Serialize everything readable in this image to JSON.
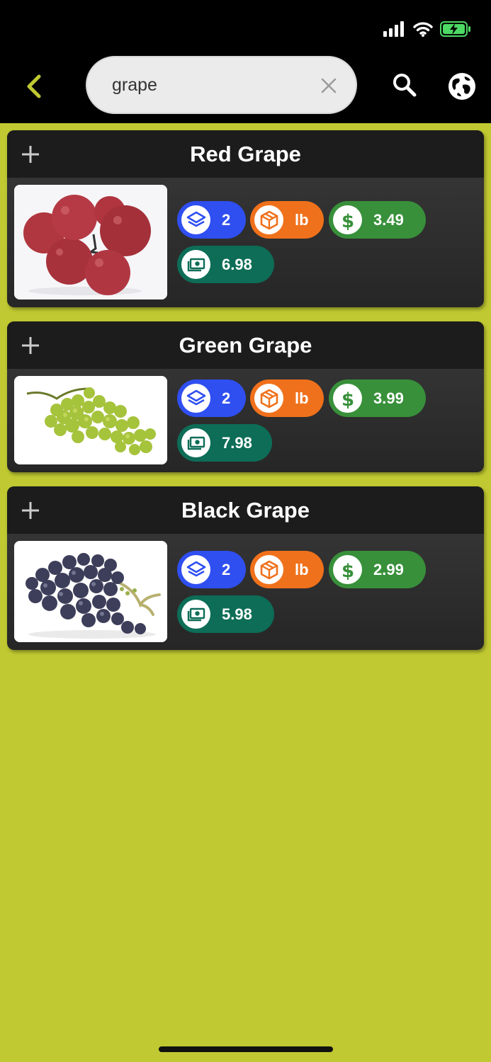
{
  "header": {
    "search_value": "grape",
    "back_icon": "chevron-left-icon",
    "search_icon": "search-icon",
    "globe_icon": "globe-icon",
    "accent_color": "#c0c931"
  },
  "items": [
    {
      "name": "Red Grape",
      "quantity": "2",
      "unit": "lb",
      "price": "3.49",
      "total": "6.98",
      "image": "red-grape-image"
    },
    {
      "name": "Green Grape",
      "quantity": "2",
      "unit": "lb",
      "price": "3.99",
      "total": "7.98",
      "image": "green-grape-image"
    },
    {
      "name": "Black Grape",
      "quantity": "2",
      "unit": "lb",
      "price": "2.99",
      "total": "5.98",
      "image": "black-grape-image"
    }
  ],
  "colors": {
    "quantity": "#2f4ff0",
    "unit": "#f0711b",
    "price": "#38903a",
    "total": "#0d6d57"
  }
}
